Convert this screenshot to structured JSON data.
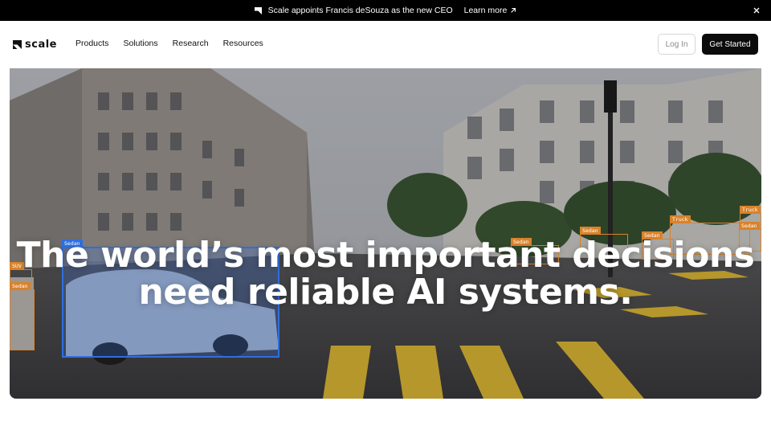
{
  "announcement": {
    "text": "Scale appoints Francis deSouza as the new CEO",
    "link_label": "Learn more"
  },
  "nav": {
    "brand": "scale",
    "menu": [
      "Products",
      "Solutions",
      "Research",
      "Resources"
    ],
    "login_label": "Log In",
    "cta_label": "Get Started"
  },
  "hero": {
    "headline_line1": "The world’s most important decisions",
    "headline_line2": "need reliable AI systems.",
    "annotations": [
      {
        "label": "Sedan",
        "color": "#2f6fe0"
      },
      {
        "label": "SUV",
        "color": "#d9822b"
      },
      {
        "label": "Sedan",
        "color": "#d9822b"
      },
      {
        "label": "Sedan",
        "color": "#d9822b"
      },
      {
        "label": "Sedan",
        "color": "#d9822b"
      },
      {
        "label": "Sedan",
        "color": "#d9822b"
      },
      {
        "label": "Truck",
        "color": "#d9822b"
      },
      {
        "label": "Truck",
        "color": "#d9822b"
      },
      {
        "label": "Sedan",
        "color": "#d9822b"
      }
    ]
  }
}
